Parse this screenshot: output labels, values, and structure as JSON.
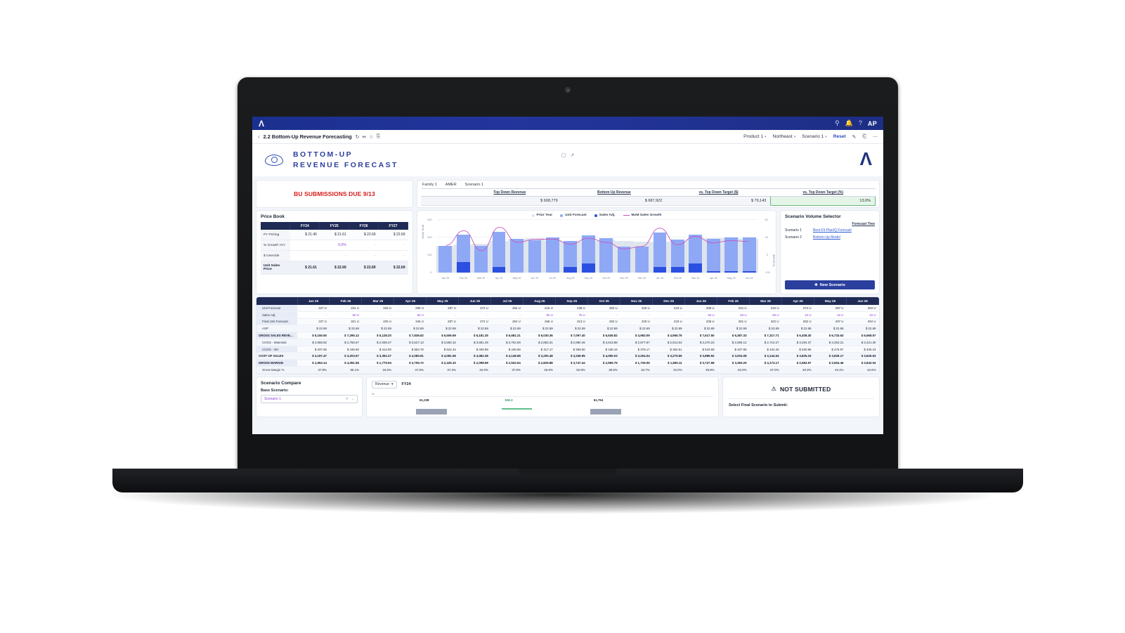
{
  "topbar": {
    "brand": "Λ",
    "icons": [
      "search-icon",
      "bell-icon",
      "help-icon"
    ],
    "avatar": "AP"
  },
  "subbar": {
    "back": "‹",
    "title": "2.2 Bottom-Up Revenue Forecasting",
    "title_icons": [
      "refresh-icon",
      "share-icon",
      "star-icon",
      "copy-icon"
    ],
    "filters": [
      {
        "label": "Product 1",
        "caret": "▾"
      },
      {
        "label": "Northeast",
        "caret": "▾"
      },
      {
        "label": "Scenario 1",
        "caret": "▾"
      }
    ],
    "reset": "Reset",
    "edit_icon": "pencil-icon",
    "save_icon": "save-icon",
    "more_icon": "ellipsis-icon"
  },
  "report": {
    "title_line1": "BOTTOM-UP",
    "title_line2": "REVENUE FORECAST",
    "tools": [
      "comment-icon",
      "expand-icon"
    ],
    "corner_logo": "Λ"
  },
  "banner": {
    "text": "BU SUBMISSIONS DUE 9/13"
  },
  "kpi": {
    "crumbs": [
      "Family 1",
      "AMER",
      "Scenario 1"
    ],
    "headers": [
      "",
      "Top Down Revenue",
      "Bottom Up Revenue",
      "vs. Top Down Target ($)",
      "vs. Top Down Target (%)"
    ],
    "values": [
      "",
      "$ 608,779",
      "$ 687,922",
      "$ 79,143",
      "13.0%"
    ]
  },
  "pricebook": {
    "title": "Price Book",
    "columns": [
      "",
      "FY24",
      "FY25",
      "FY26",
      "FY27"
    ],
    "rows": [
      {
        "label": "PY Pricing",
        "values": [
          "$ 21.40",
          "$ 21.61",
          "$ 22.69",
          "$ 22.69"
        ],
        "kind": "normal"
      },
      {
        "label": "% Growth YoY",
        "values": [
          "",
          "5.0%",
          "-",
          "-"
        ],
        "kind": "editable"
      },
      {
        "label": "$ Override",
        "values": [
          "",
          "-",
          "-",
          "-"
        ],
        "kind": "editable"
      },
      {
        "label": "Unit Sales Price",
        "values": [
          "$ 21.61",
          "$ 22.69",
          "$ 22.69",
          "$ 22.69"
        ],
        "kind": "total"
      }
    ]
  },
  "chart_data": {
    "type": "bar",
    "title": "",
    "xlabel": "",
    "ylabel": "Units Sold",
    "ylabel_right": "% Growth",
    "ylim": [
      0,
      450
    ],
    "yticks": [
      0,
      150,
      300,
      450
    ],
    "yticks_right": [
      -100,
      0,
      40,
      80
    ],
    "grid": true,
    "legend_position": "top-center",
    "categories": [
      "Jan 25",
      "Feb 25",
      "Mar 25",
      "Apr 25",
      "May 25",
      "Jun 25",
      "Jul 25",
      "Aug 25",
      "Sep 25",
      "Oct 25",
      "Nov 25",
      "Dec 25",
      "Jan 26",
      "Feb 26",
      "Mar 26",
      "Apr 26",
      "May 26",
      "Jun 26"
    ],
    "series": [
      {
        "name": "Prior Year",
        "type": "area",
        "color": "#dfe5ec",
        "values": [
          228,
          238,
          244,
          268,
          282,
          288,
          274,
          262,
          268,
          278,
          266,
          258,
          262,
          268,
          282,
          290,
          288,
          286
        ]
      },
      {
        "name": "Unit Forecast",
        "type": "bar",
        "color": "#8fa8f5",
        "values": [
          227,
          321,
          226,
          345,
          287,
          272,
          294,
          266,
          313,
          292,
          220,
          219,
          336,
          281,
          322,
          282,
          297,
          294
        ]
      },
      {
        "name": "Sales Adj.",
        "type": "bar",
        "color": "#2b4fe0",
        "values": [
          0,
          90,
          0,
          50,
          0,
          0,
          0,
          50,
          75,
          0,
          0,
          0,
          50,
          50,
          80,
          10,
          10,
          10
        ]
      },
      {
        "name": "MoM Sales Growth",
        "type": "line",
        "color": "#c356b8",
        "values": [
          -8,
          41,
          -26,
          53,
          2,
          12,
          13,
          -4,
          16,
          2,
          -20,
          -12,
          50,
          -6,
          22,
          0,
          8,
          5
        ]
      }
    ]
  },
  "scenario_selector": {
    "title": "Scenario Volume Selector",
    "col_header": "Forecast Tree",
    "rows": [
      {
        "name": "Scenario 1",
        "tree": "Best-Fit Plan/Q Forecast"
      },
      {
        "name": "Scenario 2",
        "tree": "Bottom-Up Model"
      }
    ],
    "new_button": "New Scenario",
    "new_button_icon": "plus-icon"
  },
  "grid": {
    "columns": [
      "Jan 25",
      "Feb 25",
      "Mar 25",
      "Apr 25",
      "May 25",
      "Jun 25",
      "Jul 25",
      "Aug 25",
      "Sep 25",
      "Oct 25",
      "Nov 25",
      "Dec 25",
      "Jan 26",
      "Feb 26",
      "Mar 26",
      "Apr 26",
      "May 26",
      "Jun 26"
    ],
    "rows": [
      {
        "label": "Unit Forecast",
        "bold": false,
        "adj": false,
        "values": [
          "227 U",
          "231 U",
          "226 U",
          "295 U",
          "287 U",
          "272 U",
          "294 U",
          "216 U",
          "238 U",
          "292 U",
          "220 U",
          "219 U",
          "286 U",
          "231 U",
          "242 U",
          "272 U",
          "287 U",
          "284 U"
        ]
      },
      {
        "label": "Sales Adj.",
        "bold": false,
        "adj": true,
        "values": [
          "-",
          "90 U",
          "-",
          "50 U",
          "-",
          "-",
          "-",
          "50 U",
          "75 U",
          "-",
          "-",
          "-",
          "50 U",
          "50 U",
          "80 U",
          "10 U",
          "10 U",
          "10 U"
        ]
      },
      {
        "label": "Final Unit Forecast",
        "bold": false,
        "adj": false,
        "values": [
          "227 U",
          "321 U",
          "226 U",
          "345 U",
          "287 U",
          "272 U",
          "294 U",
          "266 U",
          "313 U",
          "292 U",
          "220 U",
          "219 U",
          "336 U",
          "281 U",
          "322 U",
          "282 U",
          "297 U",
          "294 U"
        ]
      },
      {
        "label": "ASP",
        "bold": false,
        "adj": false,
        "values": [
          "$ 22.69",
          "$ 22.69",
          "$ 22.69",
          "$ 22.69",
          "$ 22.69",
          "$ 22.69",
          "$ 22.69",
          "$ 22.69",
          "$ 22.69",
          "$ 22.69",
          "$ 22.69",
          "$ 22.69",
          "$ 22.69",
          "$ 22.69",
          "$ 22.69",
          "$ 22.69",
          "$ 22.69",
          "$ 22.69"
        ]
      },
      {
        "label": "GROSS SALES REVE...",
        "bold": true,
        "adj": false,
        "values": [
          "$ 5,150.60",
          "$ 7,295.12",
          "$ 5,128.20",
          "$ 7,836.62",
          "$ 6,506.69",
          "$ 6,181.35",
          "$ 6,681.21",
          "$ 6,030.36",
          "$ 7,097.40",
          "$ 6,636.82",
          "$ 4,983.09",
          "$ 4,965.75",
          "$ 7,617.50",
          "$ 6,387.33",
          "$ 7,317.71",
          "$ 6,408.30",
          "$ 6,733.63",
          "$ 6,668.57"
        ]
      },
      {
        "label": "COGS - Materials",
        "bold": false,
        "adj": false,
        "values": [
          "$ 2,859.82",
          "$ 2,756.67",
          "$ 2,939.27",
          "$ 3,527.13",
          "$ 3,559.15",
          "$ 3,681.49",
          "$ 3,702.69",
          "$ 2,883.31",
          "$ 2,980.45",
          "$ 3,643.88",
          "$ 2,877.87",
          "$ 2,913.03",
          "$ 3,370.23",
          "$ 2,596.12",
          "$ 2,710.27",
          "$ 3,294.37",
          "$ 3,353.21",
          "$ 3,421.30"
        ]
      },
      {
        "label": "COGS - OH",
        "bold": false,
        "adj": false,
        "values": [
          "$ 337.65",
          "$ 446.90",
          "$ 413.00",
          "$ 553.78",
          "$ 522.44",
          "$ 400.89",
          "$ 445.98",
          "$ 317.17",
          "$ 369.50",
          "$ 436.16",
          "$ 376.17",
          "$ 362.61",
          "$ 519.69",
          "$ 407.95",
          "$ 434.26",
          "$ 530.96",
          "$ 475.97",
          "$ 405.23"
        ]
      },
      {
        "label": "COST OF SALES",
        "bold": true,
        "adj": false,
        "values": [
          "$ 3,197.47",
          "$ 3,203.57",
          "$ 3,352.27",
          "$ 4,080.91",
          "$ 4,081.59",
          "$ 4,082.38",
          "$ 4,148.68",
          "$ 3,200.48",
          "$ 3,349.95",
          "$ 4,080.03",
          "$ 3,254.04",
          "$ 3,275.65",
          "$ 3,889.92",
          "$ 3,004.08",
          "$ 3,144.54",
          "$ 3,825.33",
          "$ 3,829.17",
          "$ 3,826.53"
        ]
      },
      {
        "label": "GROSS MARGIN",
        "bold": true,
        "adj": false,
        "values": [
          "$ 1,953.14",
          "$ 4,091.55",
          "$ 1,775.94",
          "$ 3,755.72",
          "$ 2,425.10",
          "$ 2,098.98",
          "$ 2,532.54",
          "$ 2,829.88",
          "$ 3,747.44",
          "$ 2,556.79",
          "$ 1,729.05",
          "$ 1,690.11",
          "$ 3,727.58",
          "$ 3,383.25",
          "$ 4,173.17",
          "$ 2,582.97",
          "$ 2,904.46",
          "$ 2,842.04"
        ]
      },
      {
        "label": "Gross Margin %",
        "bold": false,
        "adj": false,
        "values": [
          "37.9%",
          "56.1%",
          "34.6%",
          "47.9%",
          "37.3%",
          "34.0%",
          "37.9%",
          "46.9%",
          "52.8%",
          "38.5%",
          "34.7%",
          "34.0%",
          "48.9%",
          "53.0%",
          "57.0%",
          "40.3%",
          "43.1%",
          "42.6%"
        ]
      }
    ]
  },
  "compare": {
    "title": "Scenario Compare",
    "base_label": "Base Scenario:",
    "selected": "Scenario 1",
    "clear_icon": "close-icon",
    "caret_icon": "chevron-down-icon"
  },
  "waterfall": {
    "metric": "Revenue",
    "metric_caret": "▾",
    "year": "FY24",
    "ytick": "6k",
    "bars": [
      {
        "label": "61,238",
        "kind": "neutral"
      },
      {
        "label": "536.3",
        "kind": "positive"
      },
      {
        "label": "61,754",
        "kind": "neutral"
      }
    ]
  },
  "submit": {
    "status": "NOT SUBMITTED",
    "status_icon": "warning-icon",
    "final_label": "Select Final Scenario to Submit:"
  },
  "colors": {
    "brand_navy": "#1f2a55",
    "accent_blue": "#2b3f9e",
    "bar_blue": "#8fa8f5",
    "bar_dark_blue": "#2b4fe0",
    "line_magenta": "#c356b8",
    "alert_red": "#d61a1a",
    "edit_purple": "#8a3ed8",
    "positive_green": "#5ec08a"
  }
}
